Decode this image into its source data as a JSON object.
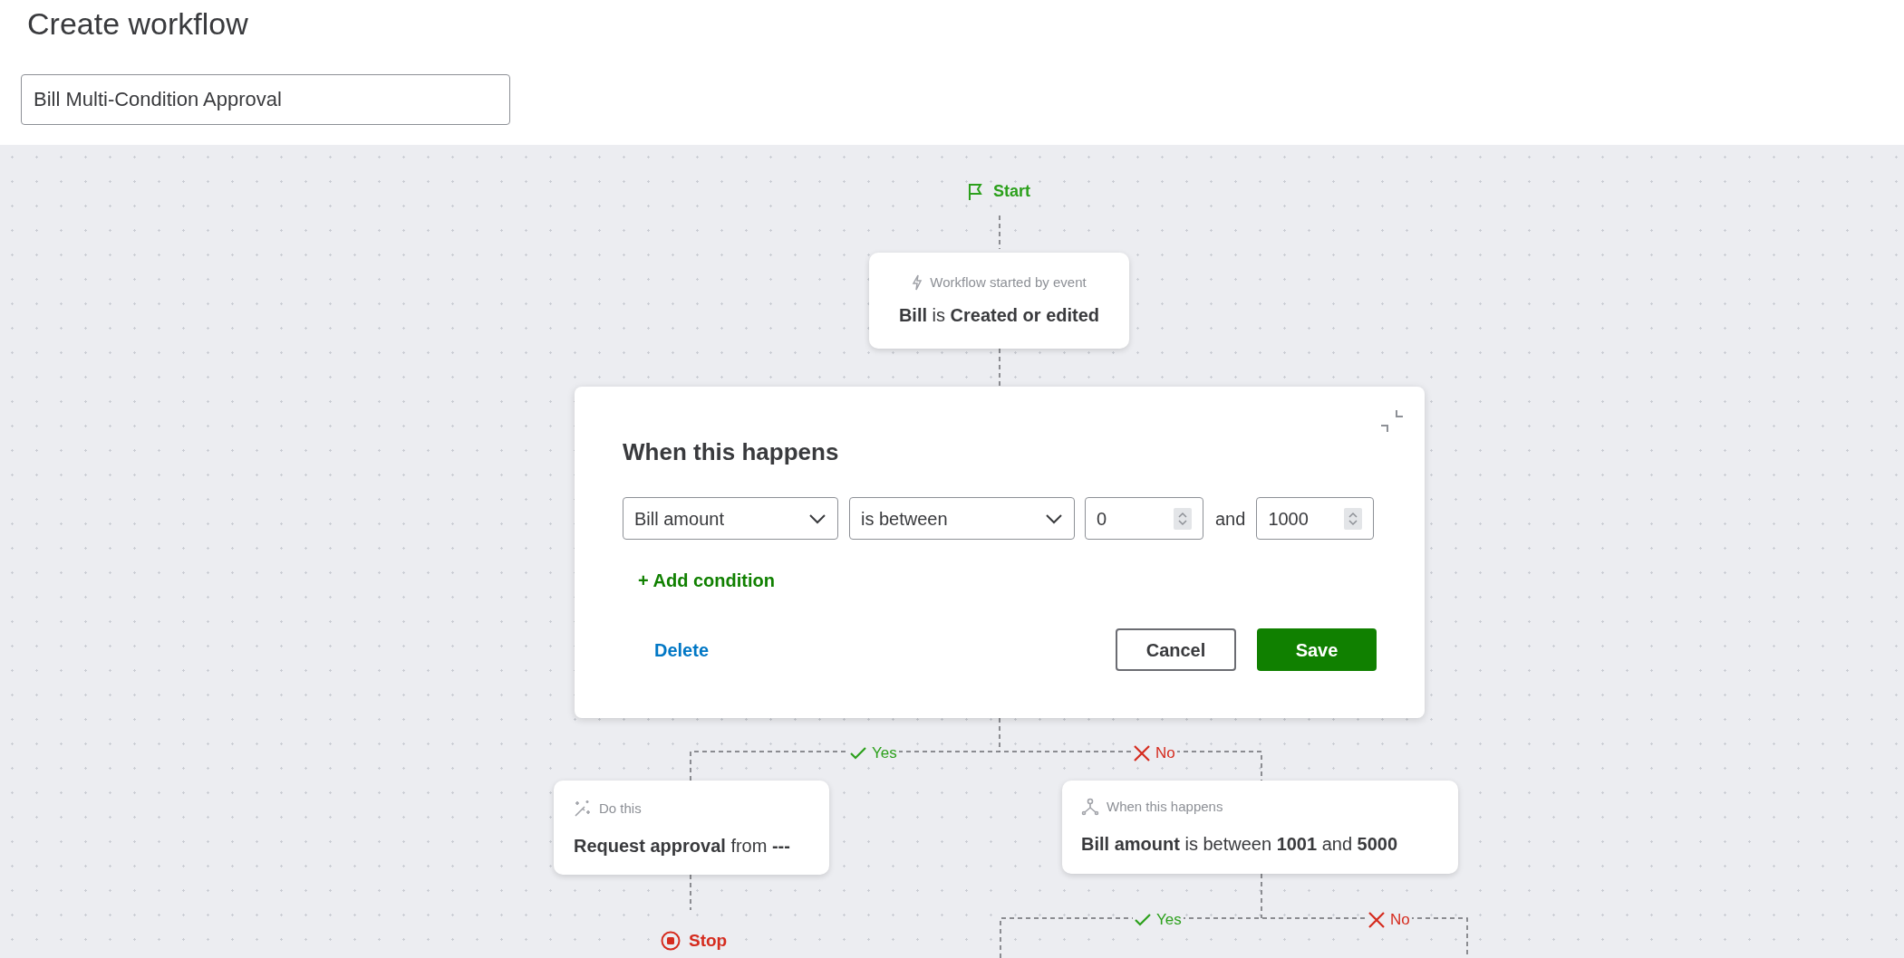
{
  "page": {
    "title": "Create workflow"
  },
  "workflow_name": {
    "value": "Bill Multi-Condition Approval"
  },
  "canvas": {
    "start": {
      "label": "Start"
    },
    "trigger_card": {
      "caption": "Workflow started by event",
      "text": "**Bill** is **Created or edited**"
    },
    "condition_editor": {
      "title": "When this happens",
      "conditions": [
        {
          "field": "Bill amount",
          "operator": "is between",
          "from": "0",
          "joiner": "and",
          "to": "1000"
        }
      ],
      "add_condition": "+ Add condition",
      "delete": "Delete",
      "cancel": "Cancel",
      "save": "Save"
    },
    "branches": [
      {
        "kind": "yes",
        "label": "Yes"
      },
      {
        "kind": "no",
        "label": "No"
      }
    ],
    "action_card": {
      "caption": "Do this",
      "text": "**Request approval** from **---**"
    },
    "stop": {
      "label": "Stop"
    },
    "nested_condition_card": {
      "caption": "When this happens",
      "text": "**Bill amount** is between **1001** and **5000**"
    },
    "nested_branches": [
      {
        "kind": "yes",
        "label": "Yes"
      },
      {
        "kind": "no",
        "label": "No"
      }
    ]
  }
}
